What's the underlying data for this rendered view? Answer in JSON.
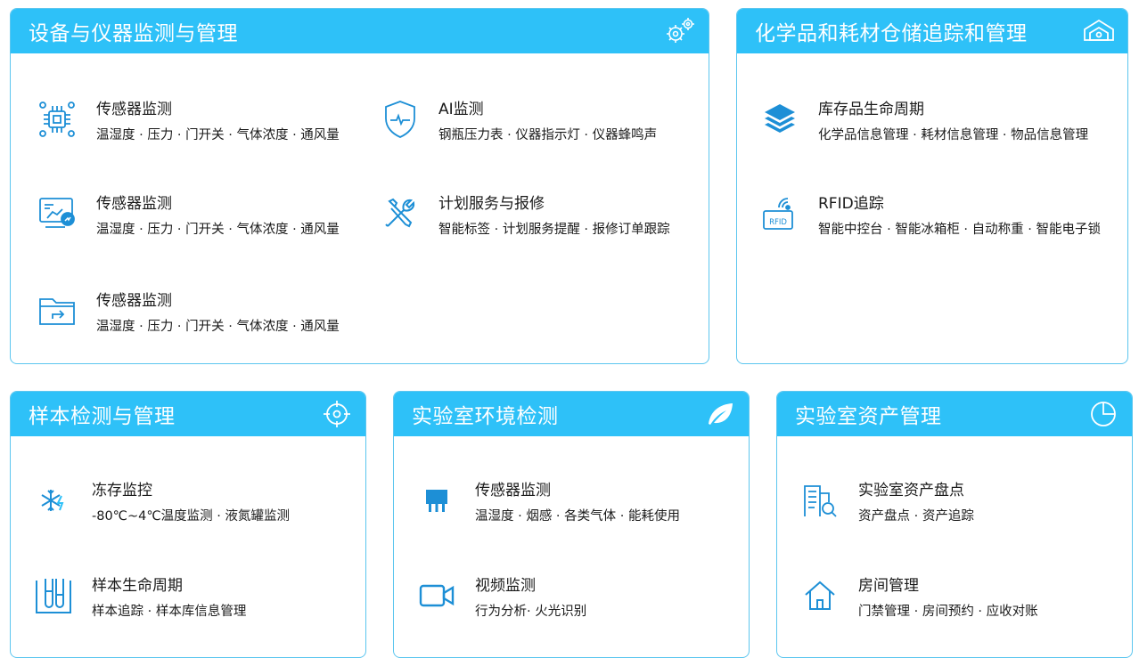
{
  "colors": {
    "header_bg": "#2ec1f8",
    "border": "#5cc6ef",
    "icon": "#1d8fd6"
  },
  "cards": {
    "equipment": {
      "title": "设备与仪器监测与管理",
      "header_icon": "gears-icon",
      "items": [
        {
          "title": "传感器监测",
          "desc": "温湿度 · 压力 · 门开关 · 气体浓度 · 通风量",
          "icon": "sensor-chip-icon"
        },
        {
          "title": "AI监测",
          "desc": "钢瓶压力表 · 仪器指示灯 · 仪器蜂鸣声",
          "icon": "shield-pulse-icon"
        },
        {
          "title": "传感器监测",
          "desc": "温湿度 · 压力 · 门开关 · 气体浓度 · 通风量",
          "icon": "monitor-arm-icon"
        },
        {
          "title": "计划服务与报修",
          "desc": "智能标签 · 计划服务提醒 · 报修订单跟踪",
          "icon": "wrench-screwdriver-icon"
        },
        {
          "title": "传感器监测",
          "desc": "温湿度 · 压力 · 门开关 · 气体浓度 · 通风量",
          "icon": "folder-share-icon"
        }
      ]
    },
    "chemicals": {
      "title": "化学品和耗材仓储追踪和管理",
      "header_icon": "warehouse-icon",
      "items": [
        {
          "title": "库存品生命周期",
          "desc": "化学品信息管理 · 耗材信息管理 · 物品信息管理",
          "icon": "layers-icon"
        },
        {
          "title": "RFID追踪",
          "desc": "智能中控台 · 智能冰箱柜 · 自动称重 · 智能电子锁",
          "icon": "rfid-icon",
          "badge": "RFID"
        }
      ]
    },
    "samples": {
      "title": "样本检测与管理",
      "header_icon": "target-icon",
      "items": [
        {
          "title": "冻存监控",
          "desc": "-80℃~4℃温度监测 · 液氮罐监测",
          "icon": "snowflake-icon"
        },
        {
          "title": "样本生命周期",
          "desc": "样本追踪 · 样本库信息管理",
          "icon": "test-tubes-icon"
        }
      ]
    },
    "environment": {
      "title": "实验室环境检测",
      "header_icon": "leaf-icon",
      "items": [
        {
          "title": "传感器监测",
          "desc": "温湿度 · 烟感 · 各类气体 · 能耗使用",
          "icon": "sensor-icon"
        },
        {
          "title": "视频监测",
          "desc": "行为分析· 火光识别",
          "icon": "video-camera-icon"
        }
      ]
    },
    "assets": {
      "title": "实验室资产管理",
      "header_icon": "pie-chart-icon",
      "items": [
        {
          "title": "实验室资产盘点",
          "desc": "资产盘点 · 资产追踪",
          "icon": "building-search-icon"
        },
        {
          "title": "房间管理",
          "desc": "门禁管理 · 房间预约 · 应收对账",
          "icon": "home-icon"
        }
      ]
    }
  }
}
